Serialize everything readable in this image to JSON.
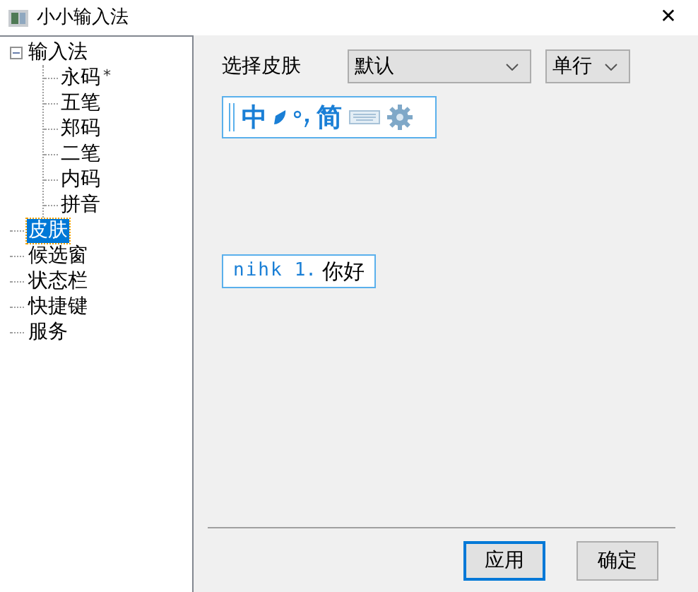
{
  "window": {
    "title": "小小输入法",
    "close": "✕"
  },
  "tree": [
    {
      "label": "输入法",
      "expanded": true,
      "selected": false,
      "toggle": "−",
      "children": [
        {
          "label": "永码",
          "mark": "*",
          "selected": false
        },
        {
          "label": "五笔",
          "selected": false
        },
        {
          "label": "郑码",
          "selected": false
        },
        {
          "label": "二笔",
          "selected": false
        },
        {
          "label": "内码",
          "selected": false
        },
        {
          "label": "拼音",
          "selected": false
        }
      ]
    },
    {
      "label": "皮肤",
      "selected": true
    },
    {
      "label": "候选窗",
      "selected": false
    },
    {
      "label": "状态栏",
      "selected": false
    },
    {
      "label": "快捷键",
      "selected": false
    },
    {
      "label": "服务",
      "selected": false
    }
  ],
  "skin": {
    "label": "选择皮肤",
    "value": "默认",
    "layout": "单行"
  },
  "status_preview": {
    "mode": "中",
    "charset": "简"
  },
  "candidate_preview": {
    "code": "nihk",
    "index": "1.",
    "word": "你好"
  },
  "buttons": [
    {
      "label": "应用",
      "focused": true
    },
    {
      "label": "确定",
      "focused": false
    }
  ]
}
